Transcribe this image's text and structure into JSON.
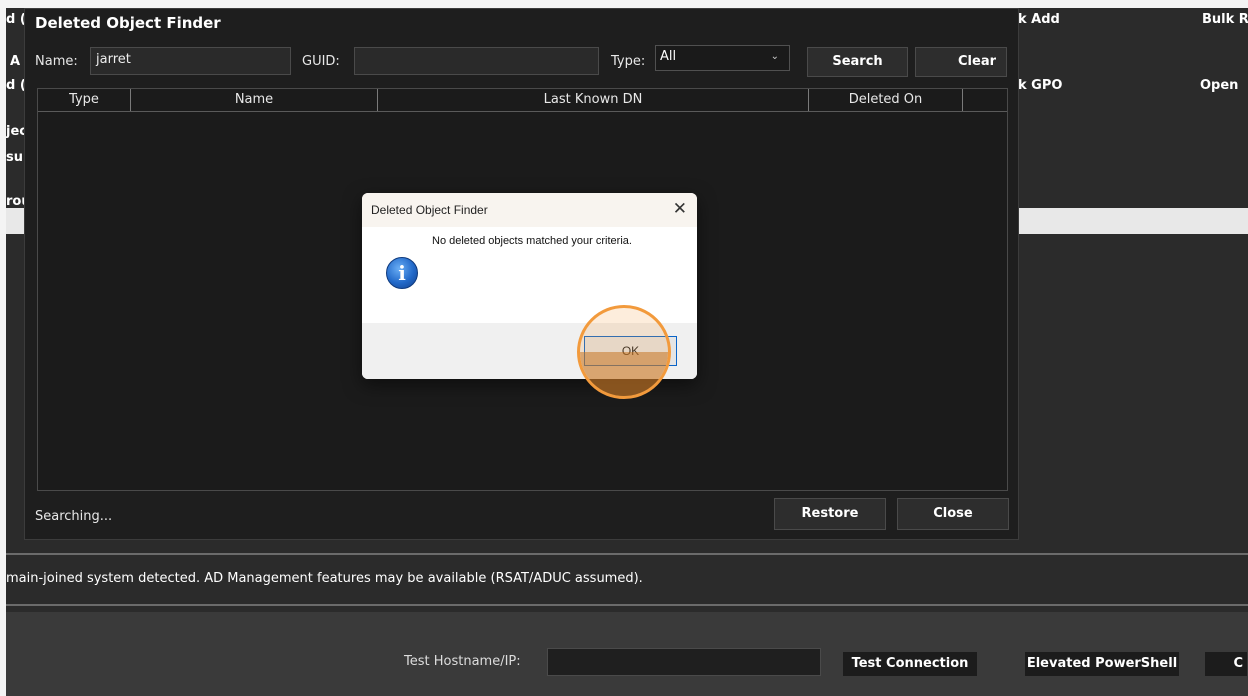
{
  "background_app": {
    "fragments": [
      "d (",
      "A",
      "d (",
      "jec",
      "sur",
      "rou"
    ],
    "right_labels": [
      "k Add",
      "Bulk R",
      "k GPO",
      "Open"
    ],
    "status_text": "main-joined system detected. AD Management features may be available (RSAT/ADUC assumed).",
    "test_hostname_label": "Test Hostname/IP:",
    "test_hostname_value": "",
    "test_connection_label": "Test Connection",
    "elevated_powershell_label": "Elevated PowerShell",
    "cut_button_label": "C"
  },
  "finder": {
    "title": "Deleted Object Finder",
    "name_label": "Name:",
    "name_value": "jarret",
    "guid_label": "GUID:",
    "guid_value": "",
    "type_label": "Type:",
    "type_value": "All",
    "search_label": "Search",
    "clear_label": "Clear",
    "columns": [
      "Type",
      "Name",
      "Last Known DN",
      "Deleted On"
    ],
    "status": "Searching...",
    "restore_label": "Restore",
    "close_label": "Close"
  },
  "message_box": {
    "title": "Deleted Object Finder",
    "message": "No deleted objects matched your criteria.",
    "ok_label": "OK",
    "close_glyph": "✕",
    "icon": "info-icon"
  },
  "colors": {
    "app_background": "#2b2b2b",
    "dialog_background": "#1e1e1e",
    "highlight": "#f29a3c",
    "ok_border": "#0a64c8"
  }
}
